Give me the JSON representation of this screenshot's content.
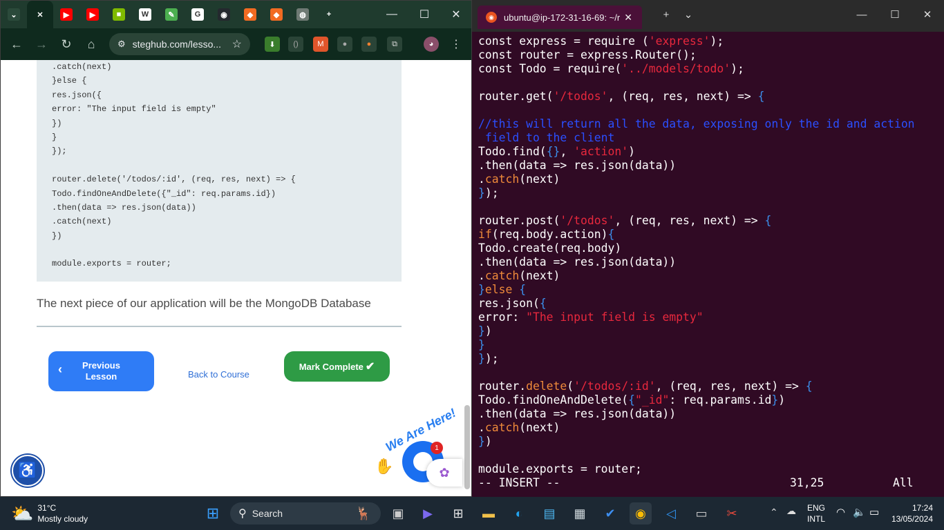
{
  "chrome": {
    "tabs": [
      {
        "name": "expand",
        "glyph": "⌄",
        "bg": "#2b4a3b"
      },
      {
        "name": "close-tab",
        "glyph": "✕",
        "bg": "#0f2a1e"
      },
      {
        "name": "youtube",
        "glyph": "▶",
        "bg": "#ff0000"
      },
      {
        "name": "youtube",
        "glyph": "▶",
        "bg": "#ff0000"
      },
      {
        "name": "microsoft",
        "glyph": "■",
        "bg": "#7fba00"
      },
      {
        "name": "wikipedia",
        "glyph": "W",
        "bg": "#ffffff"
      },
      {
        "name": "extension",
        "glyph": "✎",
        "bg": "#4caf50"
      },
      {
        "name": "google",
        "glyph": "G",
        "bg": "#ffffff"
      },
      {
        "name": "github",
        "glyph": "◉",
        "bg": "#24292e"
      },
      {
        "name": "app",
        "glyph": "◆",
        "bg": "#f26b22"
      },
      {
        "name": "app",
        "glyph": "◆",
        "bg": "#f26b22"
      },
      {
        "name": "globe",
        "glyph": "◍",
        "bg": "#6f7a74"
      },
      {
        "name": "new-tab",
        "glyph": "+",
        "bg": "transparent"
      }
    ],
    "url": "steghub.com/lesso...",
    "page": {
      "code_lines": [
        ".catch(next)",
        "}else {",
        "res.json({",
        "error: \"The input field is empty\"",
        "})",
        "}",
        "});",
        "",
        "router.delete('/todos/:id', (req, res, next) => {",
        "Todo.findOneAndDelete({\"_id\": req.params.id})",
        ".then(data => res.json(data))",
        ".catch(next)",
        "})",
        "",
        "module.exports = router;"
      ],
      "paragraph": "The next piece of our application will be the MongoDB Database",
      "prev_label_1": "Previous",
      "prev_label_2": "Lesson",
      "back_label": "Back to Course",
      "mark_label": "Mark Complete",
      "we_are_here": "We Are Here!",
      "chat_badge": "1"
    }
  },
  "terminal": {
    "tab_title": "ubuntu@ip-172-31-16-69: ~/r",
    "status_mode": "-- INSERT --",
    "status_pos": "31,25",
    "status_all": "All"
  },
  "taskbar": {
    "weather_temp": "31°C",
    "weather_desc": "Mostly cloudy",
    "search_label": "Search",
    "lang_1": "ENG",
    "lang_2": "INTL",
    "time": "17:24",
    "date": "13/05/2024"
  },
  "code_segments": [
    [
      [
        "w",
        "const express = require ("
      ],
      [
        "r",
        "'express'"
      ],
      [
        "w",
        ");"
      ]
    ],
    [
      [
        "w",
        "const router = express.Router();"
      ]
    ],
    [
      [
        "w",
        "const Todo = require("
      ],
      [
        "r",
        "'../models/todo'"
      ],
      [
        "w",
        ");"
      ]
    ],
    [],
    [
      [
        "w",
        "router.get("
      ],
      [
        "r",
        "'/todos'"
      ],
      [
        "w",
        ", (req, res, next) => "
      ],
      [
        "b",
        "{"
      ]
    ],
    [],
    [
      [
        "c",
        "//this will return all the data, exposing only the id and action"
      ]
    ],
    [
      [
        "c",
        " field to the client"
      ]
    ],
    [
      [
        "w",
        "Todo.find("
      ],
      [
        "b",
        "{}"
      ],
      [
        "w",
        ", "
      ],
      [
        "r",
        "'action'"
      ],
      [
        "w",
        ")"
      ]
    ],
    [
      [
        "w",
        ".then(data => res.json(data))"
      ]
    ],
    [
      [
        "w",
        "."
      ],
      [
        "k",
        "catch"
      ],
      [
        "w",
        "(next)"
      ]
    ],
    [
      [
        "b",
        "}"
      ],
      [
        "w",
        ");"
      ]
    ],
    [],
    [
      [
        "w",
        "router.post("
      ],
      [
        "r",
        "'/todos'"
      ],
      [
        "w",
        ", (req, res, next) => "
      ],
      [
        "b",
        "{"
      ]
    ],
    [
      [
        "k",
        "if"
      ],
      [
        "w",
        "(req.body.action)"
      ],
      [
        "b",
        "{"
      ]
    ],
    [
      [
        "w",
        "Todo.create(req.body)"
      ]
    ],
    [
      [
        "w",
        ".then(data => res.json(data))"
      ]
    ],
    [
      [
        "w",
        "."
      ],
      [
        "k",
        "catch"
      ],
      [
        "w",
        "(next)"
      ]
    ],
    [
      [
        "b",
        "}"
      ],
      [
        "k",
        "else"
      ],
      [
        "w",
        " "
      ],
      [
        "b",
        "{"
      ]
    ],
    [
      [
        "w",
        "res.json("
      ],
      [
        "b",
        "{"
      ]
    ],
    [
      [
        "w",
        "error: "
      ],
      [
        "r",
        "\"The input field is empty\""
      ]
    ],
    [
      [
        "b",
        "}"
      ],
      [
        "w",
        ")"
      ]
    ],
    [
      [
        "b",
        "}"
      ]
    ],
    [
      [
        "b",
        "}"
      ],
      [
        "w",
        ");"
      ]
    ],
    [],
    [
      [
        "w",
        "router."
      ],
      [
        "k",
        "delete"
      ],
      [
        "w",
        "("
      ],
      [
        "r",
        "'/todos/:id'"
      ],
      [
        "w",
        ", (req, res, next) => "
      ],
      [
        "b",
        "{"
      ]
    ],
    [
      [
        "w",
        "Todo.findOneAndDelete("
      ],
      [
        "b",
        "{"
      ],
      [
        "r",
        "\"_id\""
      ],
      [
        "w",
        ": req.params.id"
      ],
      [
        "b",
        "}"
      ],
      [
        "w",
        ")"
      ]
    ],
    [
      [
        "w",
        ".then(data => res.json(data))"
      ]
    ],
    [
      [
        "w",
        "."
      ],
      [
        "k",
        "catch"
      ],
      [
        "w",
        "(next)"
      ]
    ],
    [
      [
        "b",
        "}"
      ],
      [
        "w",
        ")"
      ]
    ],
    [],
    [
      [
        "w",
        "module.exports = router;"
      ]
    ]
  ]
}
